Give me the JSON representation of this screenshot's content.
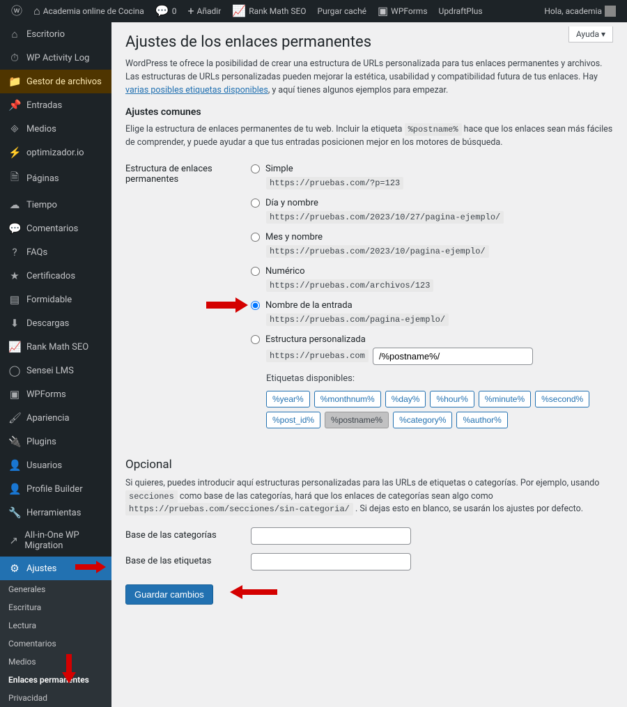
{
  "toolbar": {
    "site_name": "Academia online de Cocina",
    "comments_count": "0",
    "add_label": "Añadir",
    "rank_math": "Rank Math SEO",
    "purge_cache": "Purgar caché",
    "wpforms": "WPForms",
    "updraft": "UpdraftPlus",
    "greeting": "Hola, academia"
  },
  "sidebar": {
    "items": [
      {
        "icon": "⌂",
        "label": "Escritorio"
      },
      {
        "icon": "⏱",
        "label": "WP Activity Log"
      },
      {
        "icon": "📁",
        "label": "Gestor de archivos",
        "highlight": true
      },
      {
        "icon": "📌",
        "label": "Entradas"
      },
      {
        "icon": "🞜",
        "label": "Medios"
      },
      {
        "icon": "⚡",
        "label": "optimizador.io"
      },
      {
        "icon": "🗎",
        "label": "Páginas"
      },
      {
        "icon": "☁",
        "label": "Tiempo"
      },
      {
        "icon": "💬",
        "label": "Comentarios"
      },
      {
        "icon": "?",
        "label": "FAQs"
      },
      {
        "icon": "★",
        "label": "Certificados"
      },
      {
        "icon": "▤",
        "label": "Formidable"
      },
      {
        "icon": "⬇",
        "label": "Descargas"
      },
      {
        "icon": "📈",
        "label": "Rank Math SEO"
      },
      {
        "icon": "◯",
        "label": "Sensei LMS"
      },
      {
        "icon": "▣",
        "label": "WPForms"
      },
      {
        "icon": "🖌",
        "label": "Apariencia"
      },
      {
        "icon": "🔌",
        "label": "Plugins"
      },
      {
        "icon": "👤",
        "label": "Usuarios"
      },
      {
        "icon": "👤",
        "label": "Profile Builder"
      },
      {
        "icon": "🔧",
        "label": "Herramientas"
      },
      {
        "icon": "↗",
        "label": "All-in-One WP Migration"
      },
      {
        "icon": "⚙",
        "label": "Ajustes",
        "current": true
      }
    ],
    "submenu": [
      {
        "label": "Generales"
      },
      {
        "label": "Escritura"
      },
      {
        "label": "Lectura"
      },
      {
        "label": "Comentarios"
      },
      {
        "label": "Medios"
      },
      {
        "label": "Enlaces permanentes",
        "current": true
      },
      {
        "label": "Privacidad"
      }
    ]
  },
  "page": {
    "title": "Ajustes de los enlaces permanentes",
    "help": "Ayuda ▾",
    "intro_pre": "WordPress te ofrece la posibilidad de crear una estructura de URLs personalizada para tus enlaces permanentes y archivos. Las estructuras de URLs personalizadas pueden mejorar la estética, usabilidad y compatibilidad futura de tus enlaces. Hay ",
    "intro_link": "varias posibles etiquetas disponibles",
    "intro_post": ", y aquí tienes algunos ejemplos para empezar.",
    "common_heading": "Ajustes comunes",
    "common_desc_pre": "Elige la estructura de enlaces permanentes de tu web. Incluir la etiqueta ",
    "common_tag": "%postname%",
    "common_desc_post": " hace que los enlaces sean más fáciles de comprender, y puede ayudar a que tus entradas posicionen mejor en los motores de búsqueda.",
    "structure_label": "Estructura de enlaces permanentes",
    "structures": [
      {
        "label": "Simple",
        "example": "https://pruebas.com/?p=123"
      },
      {
        "label": "Día y nombre",
        "example": "https://pruebas.com/2023/10/27/pagina-ejemplo/"
      },
      {
        "label": "Mes y nombre",
        "example": "https://pruebas.com/2023/10/pagina-ejemplo/"
      },
      {
        "label": "Numérico",
        "example": "https://pruebas.com/archivos/123"
      },
      {
        "label": "Nombre de la entrada",
        "example": "https://pruebas.com/pagina-ejemplo/",
        "checked": true
      },
      {
        "label": "Estructura personalizada"
      }
    ],
    "custom_base": "https://pruebas.com",
    "custom_value": "/%postname%/",
    "tags_label": "Etiquetas disponibles:",
    "tags": [
      {
        "t": "%year%"
      },
      {
        "t": "%monthnum%"
      },
      {
        "t": "%day%"
      },
      {
        "t": "%hour%"
      },
      {
        "t": "%minute%"
      },
      {
        "t": "%second%"
      },
      {
        "t": "%post_id%"
      },
      {
        "t": "%postname%",
        "active": true
      },
      {
        "t": "%category%"
      },
      {
        "t": "%author%"
      }
    ],
    "optional_heading": "Opcional",
    "optional_desc_pre": "Si quieres, puedes introducir aquí estructuras personalizadas para las URLs de etiquetas o categorías. Por ejemplo, usando ",
    "optional_code1": "secciones",
    "optional_desc_mid": " como base de las categorías, hará que los enlaces de categorías sean algo como ",
    "optional_code2": "https://pruebas.com/secciones/sin-categoria/",
    "optional_desc_post": " . Si dejas esto en blanco, se usarán los ajustes por defecto.",
    "cat_base_label": "Base de las categorías",
    "tag_base_label": "Base de las etiquetas",
    "save": "Guardar cambios"
  }
}
